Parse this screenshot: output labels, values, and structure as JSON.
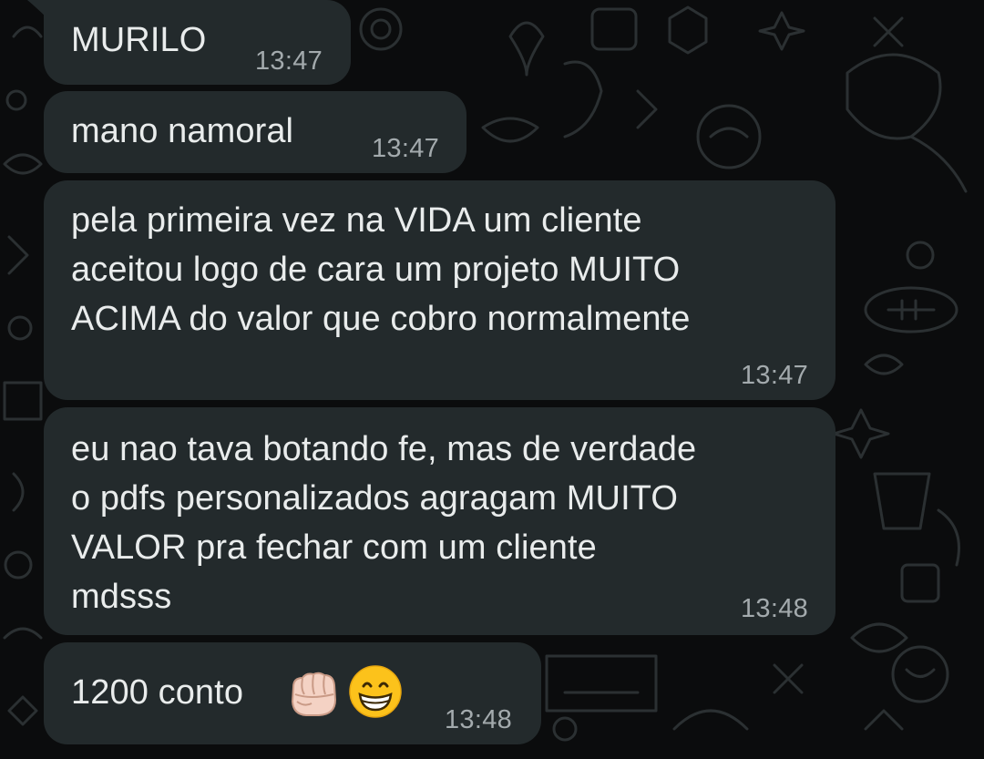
{
  "messages": [
    {
      "text": "MURILO",
      "time": "13:47"
    },
    {
      "text": "mano namoral",
      "time": "13:47"
    },
    {
      "text": "pela primeira vez na VIDA um cliente\naceitou logo de cara um projeto MUITO\nACIMA do valor que cobro normalmente",
      "time": "13:47"
    },
    {
      "text": "eu nao tava botando fe, mas de verdade\no pdfs personalizados agragam MUITO\nVALOR pra fechar com um cliente\nmdsss",
      "time": "13:48"
    },
    {
      "text": "1200 conto",
      "time": "13:48",
      "emojis": [
        "fist-icon",
        "grinning-face-icon"
      ]
    }
  ],
  "colors": {
    "background": "#0b0c0d",
    "bubble": "#232a2c",
    "text": "#e9ecec",
    "time": "#a3aaad",
    "doodle": "#2a2f31"
  }
}
